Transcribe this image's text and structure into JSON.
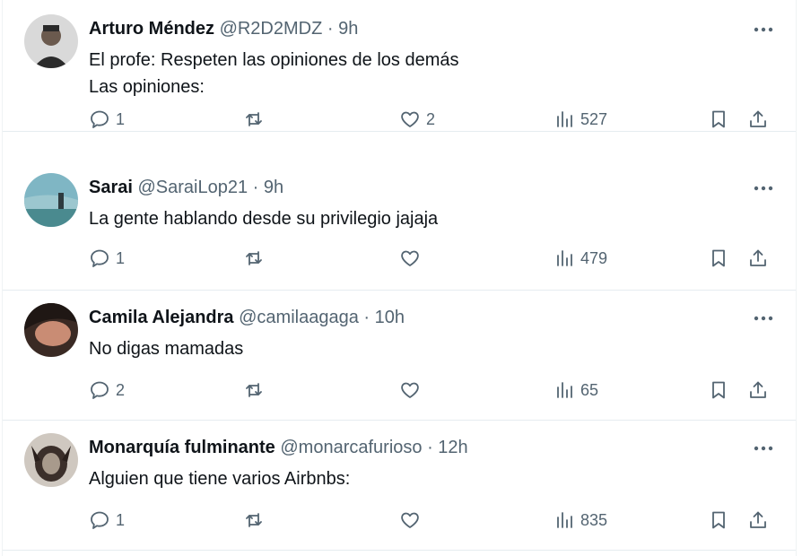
{
  "colors": {
    "text": "#0f1419",
    "muted": "#536471",
    "divider": "#e6ecf0"
  },
  "icons": {
    "reply": "reply-icon",
    "retweet": "retweet-icon",
    "like": "heart-icon",
    "views": "views-icon",
    "bookmark": "bookmark-icon",
    "share": "share-icon",
    "more": "more-icon"
  },
  "tweets": [
    {
      "name": "Arturo Méndez",
      "handle": "@R2D2MDZ",
      "time": "9h",
      "text": "El profe: Respeten las opiniones de los demás\nLas opiniones:",
      "replies": "1",
      "retweets": "",
      "likes": "2",
      "views": "527"
    },
    {
      "name": "Sarai",
      "handle": "@SaraiLop21",
      "time": "9h",
      "text": "La gente hablando desde su privilegio jajaja",
      "replies": "1",
      "retweets": "",
      "likes": "",
      "views": "479"
    },
    {
      "name": "Camila Alejandra",
      "handle": "@camilaagaga",
      "time": "10h",
      "text": "No digas mamadas",
      "replies": "2",
      "retweets": "",
      "likes": "",
      "views": "65"
    },
    {
      "name": "Monarquía fulminante",
      "handle": "@monarcafurioso",
      "time": "12h",
      "text": "Alguien que tiene varios Airbnbs:",
      "replies": "1",
      "retweets": "",
      "likes": "",
      "views": "835"
    }
  ]
}
